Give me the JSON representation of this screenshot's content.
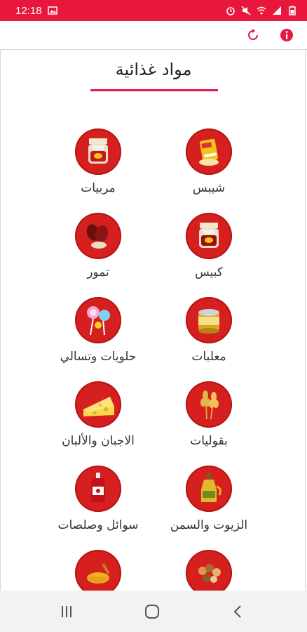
{
  "status_bar": {
    "time": "12:18",
    "icons": [
      "image-icon",
      "alarm-icon",
      "mute-icon",
      "wifi-icon",
      "signal-icon",
      "battery-icon"
    ]
  },
  "app_bar": {
    "icons": [
      "refresh-icon",
      "info-icon"
    ]
  },
  "page": {
    "title": "مواد غذائية"
  },
  "categories": [
    {
      "label": "شيبس",
      "icon": "chips-icon"
    },
    {
      "label": "مربيات",
      "icon": "jam-jar-icon"
    },
    {
      "label": "كبيس",
      "icon": "pickles-jar-icon"
    },
    {
      "label": "تمور",
      "icon": "dates-icon"
    },
    {
      "label": "معلبات",
      "icon": "canned-food-icon"
    },
    {
      "label": "حلويات وتسالي",
      "icon": "lollipop-icon"
    },
    {
      "label": "بقوليات",
      "icon": "wheat-icon"
    },
    {
      "label": "الاجبان والألبان",
      "icon": "cheese-icon"
    },
    {
      "label": "الزيوت والسمن",
      "icon": "oil-bottle-icon"
    },
    {
      "label": "سوائل وصلصات",
      "icon": "ketchup-icon"
    },
    {
      "label": "",
      "icon": "nuts-icon"
    },
    {
      "label": "",
      "icon": "spices-icon"
    }
  ],
  "nav_bar": {
    "icons": [
      "recent-apps-icon",
      "home-icon",
      "back-icon"
    ]
  },
  "colors": {
    "accent": "#e8173b",
    "circle": "#d61f1f"
  }
}
